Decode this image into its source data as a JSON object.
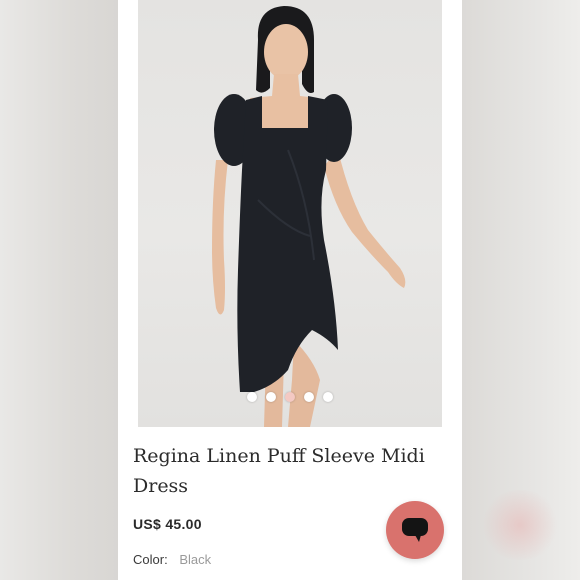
{
  "product": {
    "title_line1": "Regina Linen Puff Sleeve Midi",
    "title_line2": "Dress",
    "price": "US$ 45.00",
    "color_label": "Color:",
    "color_value": "Black"
  },
  "gallery": {
    "image_count": 5,
    "active_index": 2
  },
  "theme": {
    "accent": "#d9726d",
    "active_dot": "#f4c9c3",
    "dress": "#1f2228"
  },
  "icons": {
    "chat": "chat-bubble-icon"
  }
}
